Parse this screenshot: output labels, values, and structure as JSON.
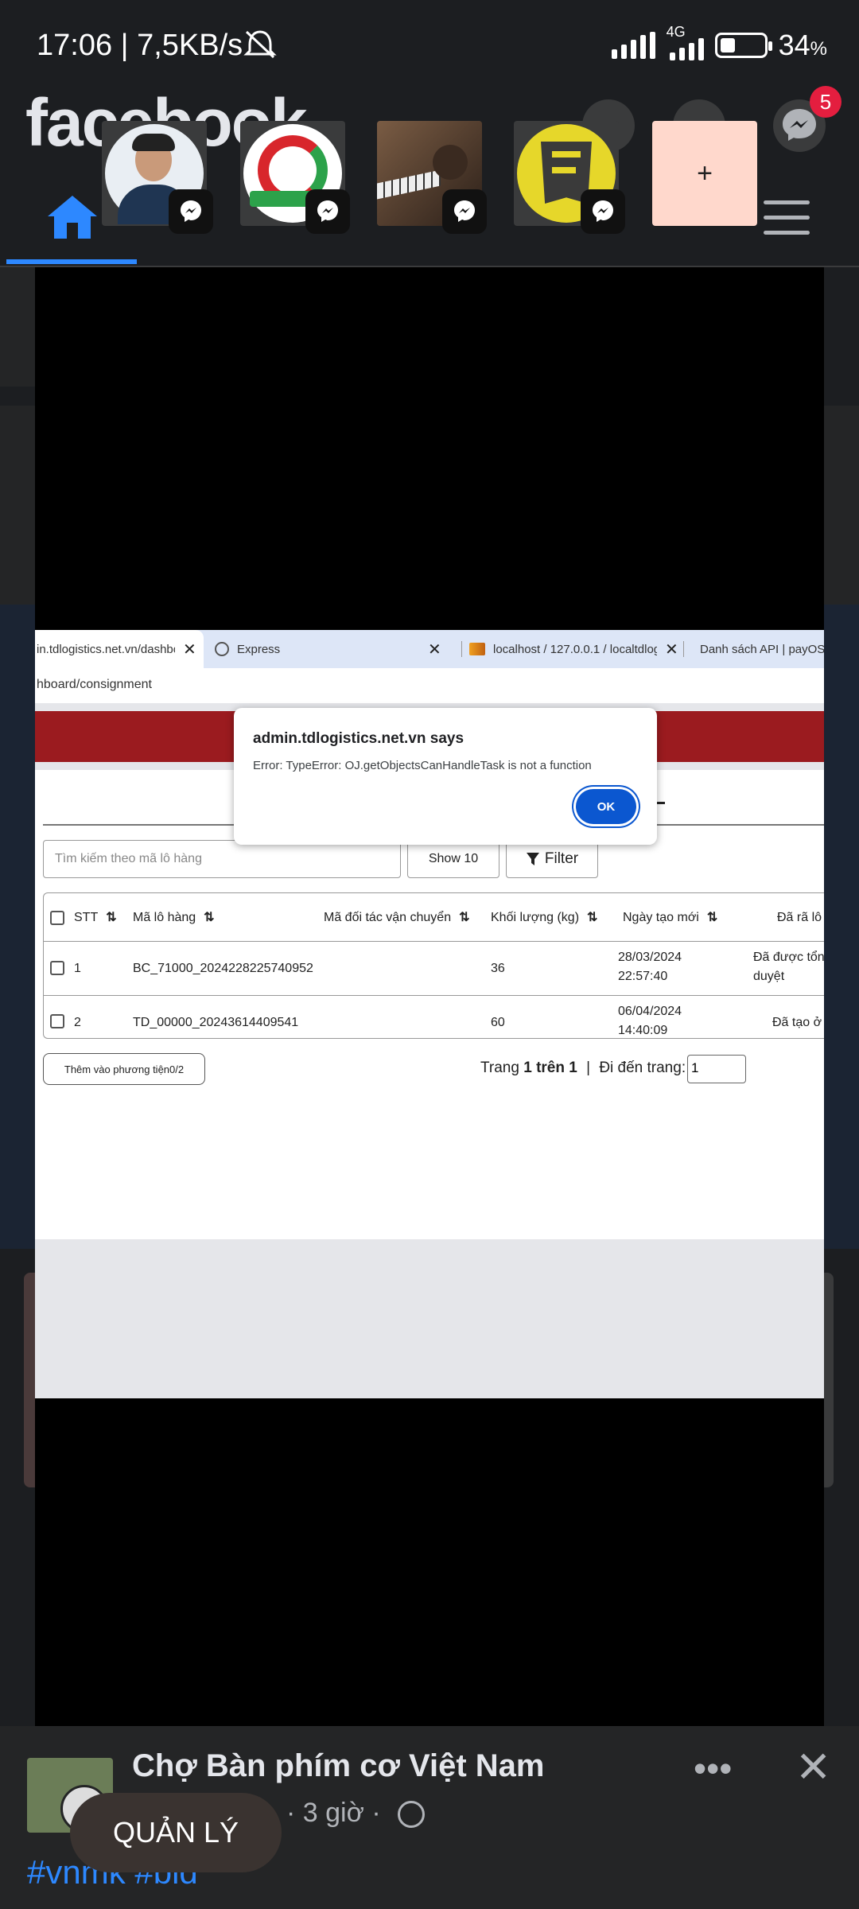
{
  "status_bar": {
    "time": "17:06 | 7,5KB/s",
    "network": "4G",
    "battery": "34",
    "battery_unit": "%"
  },
  "facebook": {
    "logo": "facebook",
    "messenger_badge": "5",
    "bottom_post": {
      "group_title": "Chợ Bàn phím cơ Việt Nam",
      "meta": "· 3 giờ ·",
      "tags": "#vnmk #bid",
      "more": "•••",
      "close": "✕"
    }
  },
  "chat_heads": {
    "add_label": "+"
  },
  "browser": {
    "tabs": [
      {
        "label": "in.tdlogistics.net.vn/dashbo",
        "close": "✕"
      },
      {
        "label": "Express",
        "close": "✕"
      },
      {
        "label": "localhost / 127.0.0.1 / localtdlog",
        "close": "✕"
      },
      {
        "label": "Danh sách API | payOS"
      }
    ],
    "address": "hboard/consignment",
    "search_placeholder": "Tìm kiếm theo mã lô hàng",
    "show_label": "Show 10",
    "filter_label": "Filter",
    "table": {
      "headers": [
        "STT",
        "Mã lô hàng",
        "Mã đối tác vận chuyển",
        "Khối lượng (kg)",
        "Ngày tạo mới",
        "Đã rã lô"
      ],
      "rows": [
        {
          "stt": "1",
          "code": "BC_71000_2024228225740952",
          "partner": "",
          "weight": "36",
          "date": "28/03/2024",
          "time": "22:57:40",
          "status1": "Đã được tổng",
          "status2": "duyệt"
        },
        {
          "stt": "2",
          "code": "TD_00000_20243614409541",
          "partner": "",
          "weight": "60",
          "date": "06/04/2024",
          "time": "14:40:09",
          "status1": "Đã tạo ở b",
          "status2": ""
        }
      ]
    },
    "add_vehicle_label": "Thêm vào phương tiện0/2",
    "pager": {
      "prefix": "Trang ",
      "current": "1 trên 1",
      "sep": "|",
      "goto": "Đi đến trang:",
      "input_value": "1"
    }
  },
  "dialog": {
    "title": "admin.tdlogistics.net.vn says",
    "message": "Error: TypeError: OJ.getObjectsCanHandleTask is not a function",
    "ok_label": "OK"
  },
  "floating_button": {
    "label": "QUẢN LÝ"
  },
  "colors": {
    "brand_red": "#9b1b1f",
    "ok_blue": "#0b57d0",
    "fb_blue": "#2d88ff"
  }
}
